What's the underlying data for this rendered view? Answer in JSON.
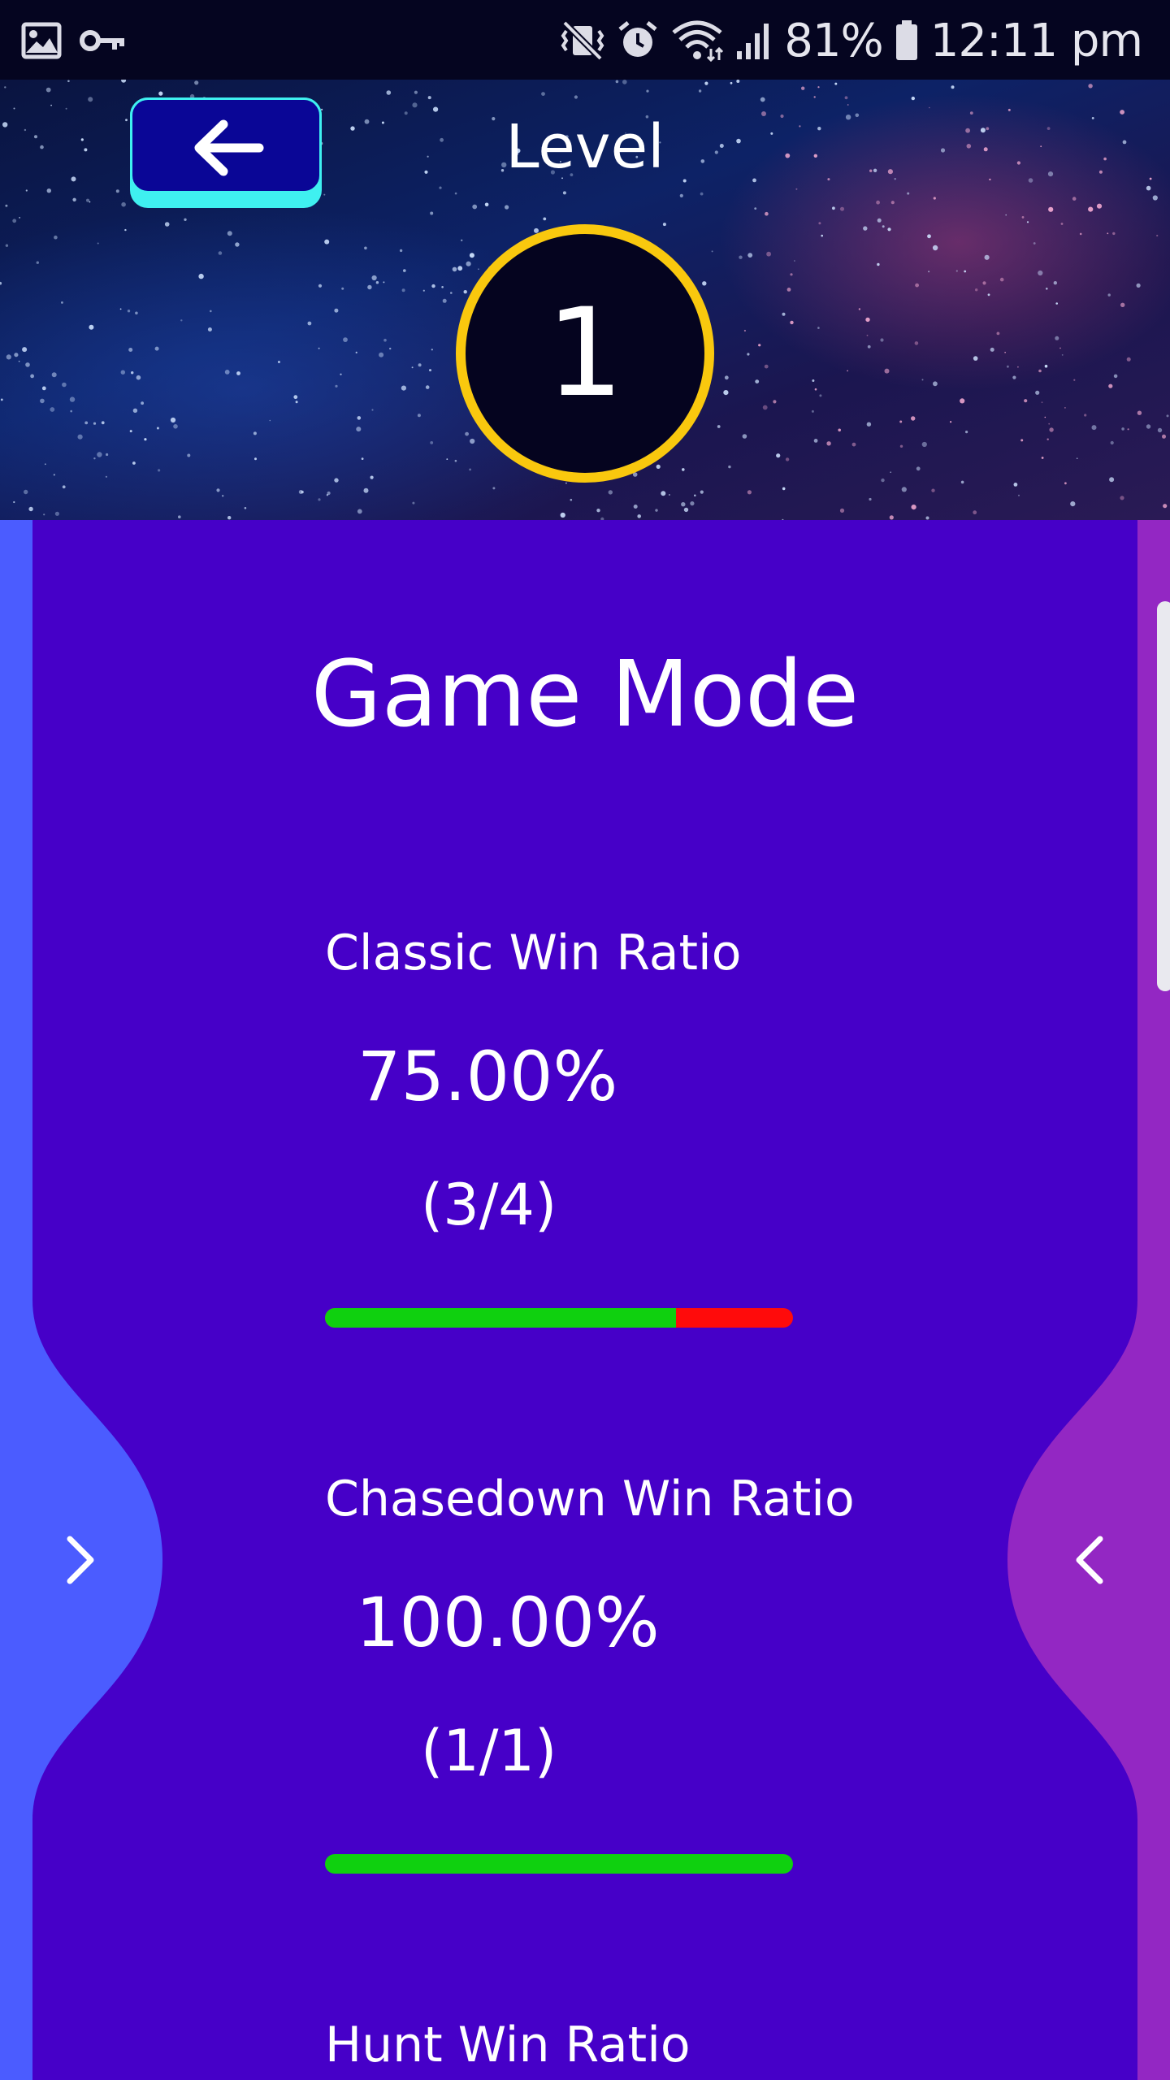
{
  "status_bar": {
    "battery_percent": "81%",
    "time": "12:11 pm",
    "left_icons": [
      "image-icon",
      "key-icon"
    ],
    "right_icons": [
      "mute-vibrate-icon",
      "alarm-icon",
      "wifi-icon",
      "signal-icon",
      "battery-icon"
    ]
  },
  "header": {
    "back_icon": "arrow-left-icon",
    "level_label": "Level",
    "level_value": "1"
  },
  "game_mode": {
    "title": "Game Mode",
    "stats": [
      {
        "label": "Classic Win Ratio",
        "percent": "75.00%",
        "count": "(3/4)",
        "ratio": 0.75
      },
      {
        "label": "Chasedown Win Ratio",
        "percent": "100.00%",
        "count": "(1/1)",
        "ratio": 1.0
      },
      {
        "label": "Hunt Win Ratio"
      }
    ]
  },
  "navigation": {
    "left_arrow_icon": "chevron-right-icon",
    "right_arrow_icon": "chevron-left-icon"
  },
  "colors": {
    "panel": "#4600c8",
    "left_panel": "#4b5cff",
    "right_panel": "#9327c3",
    "badge_ring": "#f9c80e",
    "back_button": "#0a0696",
    "back_button_edge": "#3ff0f0",
    "win_bar": "#0fd00f",
    "loss_bar": "#ff0b0b"
  }
}
